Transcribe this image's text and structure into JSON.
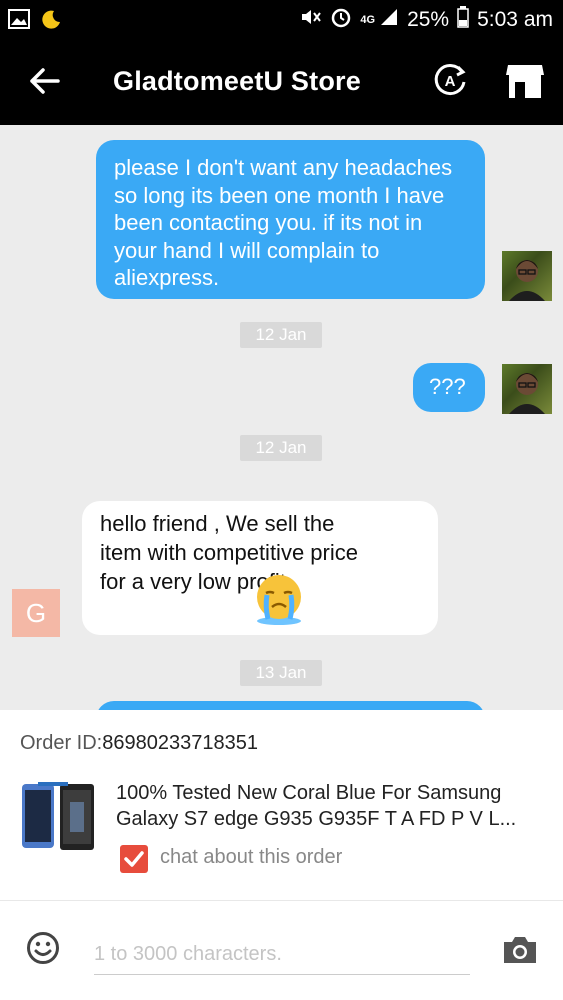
{
  "status_bar": {
    "signal_label": "4G",
    "battery": "25%",
    "time": "5:03 am"
  },
  "header": {
    "title": "GladtomeetU Store",
    "icons": [
      "back-arrow-icon",
      "translate-icon",
      "store-icon"
    ]
  },
  "messages": [
    {
      "type": "outgoing",
      "text": "please I don't want any headaches so long its been one month I have been contacting you. if its not in your hand I will complain to aliexpress."
    },
    {
      "type": "date",
      "text": "12 Jan"
    },
    {
      "type": "outgoing",
      "text": "???"
    },
    {
      "type": "date",
      "text": "12 Jan"
    },
    {
      "type": "incoming",
      "text": "hello friend , We sell the item with competitive price for a very low profit",
      "sender_initial": "G",
      "emoji": "crying-face-emoji"
    },
    {
      "type": "date",
      "text": "13 Jan"
    }
  ],
  "order": {
    "label": "Order ID:",
    "id": "86980233718351",
    "product_title": "100% Tested New Coral Blue For Samsung Galaxy S7 edge G935 G935F T A FD P V L...",
    "chat_option": "chat about this order",
    "chat_option_checked": true
  },
  "input": {
    "placeholder": "1 to 3000 characters.",
    "value": ""
  },
  "colors": {
    "outgoing_bubble": "#3aa9f5",
    "incoming_bubble": "#ffffff",
    "header_bg": "#000000",
    "chat_bg": "#ececec",
    "checkbox": "#e74c3c",
    "avatar_g": "#f4b8a6"
  }
}
